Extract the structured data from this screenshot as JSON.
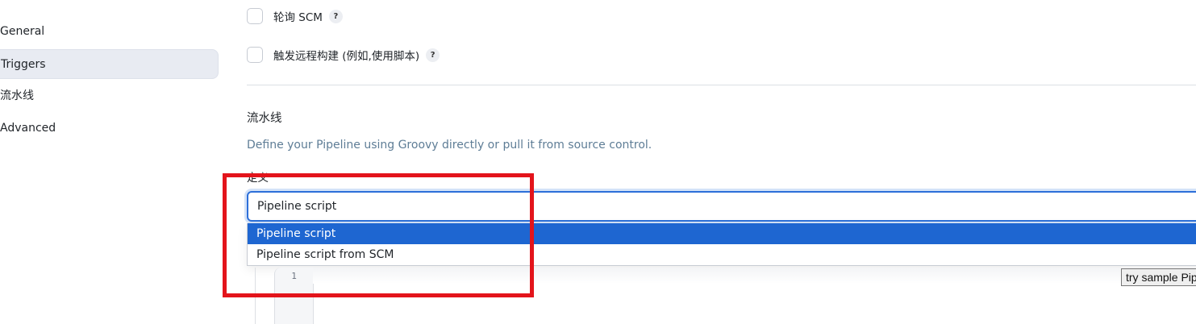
{
  "sidebar": {
    "items": [
      {
        "label": "General",
        "active": false
      },
      {
        "label": "Triggers",
        "active": true
      },
      {
        "label": "流水线",
        "active": false
      },
      {
        "label": "Advanced",
        "active": false
      }
    ]
  },
  "triggers": {
    "poll_scm": {
      "label": "轮询 SCM",
      "checked": false,
      "help": "?"
    },
    "remote_build": {
      "label": "触发远程构建 (例如,使用脚本)",
      "checked": false,
      "help": "?"
    }
  },
  "pipeline": {
    "title": "流水线",
    "description": "Define your Pipeline using Groovy directly or pull it from source control.",
    "definition_label": "定义",
    "select_value": "Pipeline script",
    "options": [
      {
        "label": "Pipeline script",
        "selected": true
      },
      {
        "label": "Pipeline script from SCM",
        "selected": false
      }
    ],
    "editor": {
      "line_number": "1",
      "sample_button": "try sample Pipeline..."
    }
  },
  "colors": {
    "accent": "#2c6fd9",
    "selected_option": "#1e66d1",
    "highlight": "#e3141b"
  }
}
